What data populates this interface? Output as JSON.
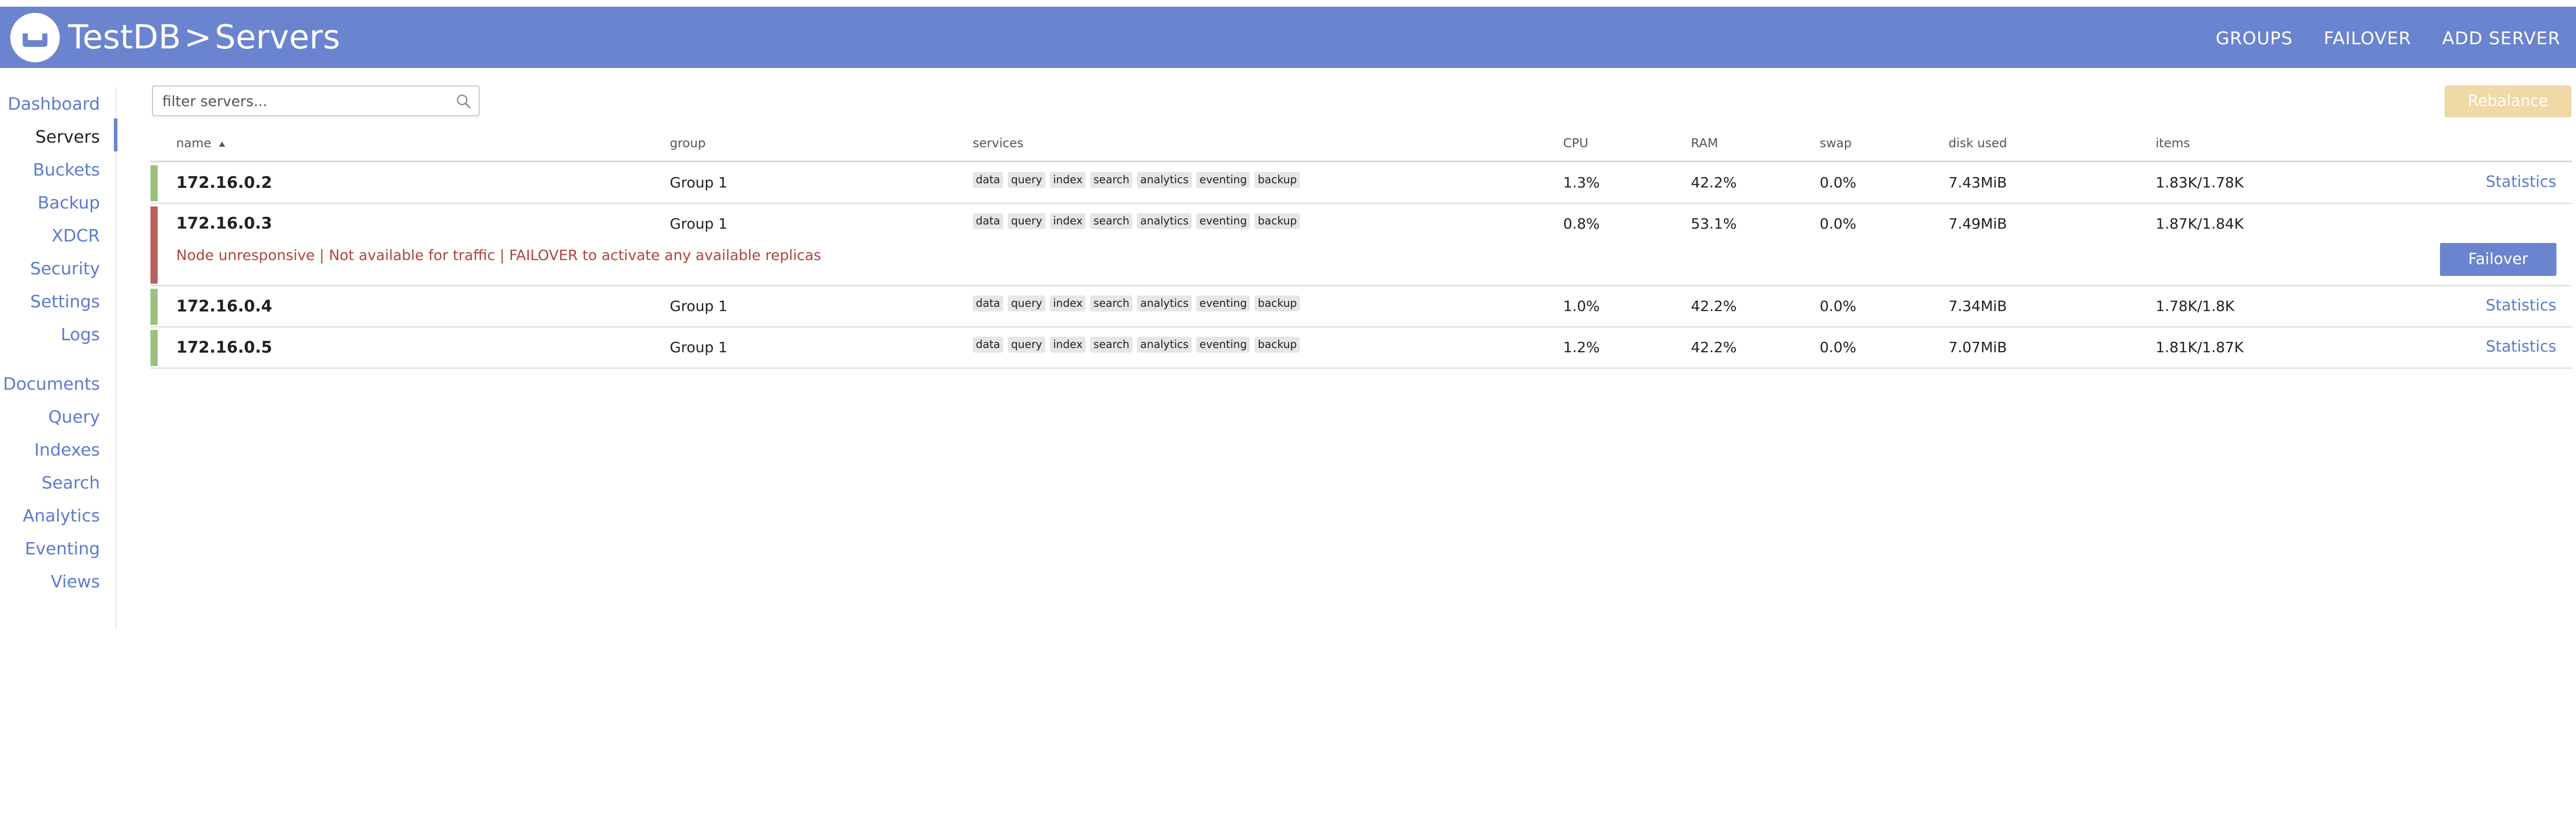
{
  "header": {
    "app": "TestDB",
    "separator": ">",
    "page": "Servers",
    "actions": [
      "GROUPS",
      "FAILOVER",
      "ADD SERVER"
    ],
    "color": "#6b84d0"
  },
  "sidebar": {
    "active": "Servers",
    "items": [
      "Dashboard",
      "Servers",
      "Buckets",
      "Backup",
      "XDCR",
      "Security",
      "Settings",
      "Logs"
    ],
    "items2": [
      "Documents",
      "Query",
      "Indexes",
      "Search",
      "Analytics",
      "Eventing",
      "Views"
    ]
  },
  "filter": {
    "placeholder": "filter servers..."
  },
  "rebalance_label": "Rebalance",
  "columns": {
    "name": "name",
    "group": "group",
    "services": "services",
    "cpu": "CPU",
    "ram": "RAM",
    "swap": "swap",
    "disk": "disk used",
    "items": "items",
    "sort": "name ascending"
  },
  "rows": [
    {
      "name": "172.16.0.2",
      "group": "Group 1",
      "services": [
        "data",
        "query",
        "index",
        "search",
        "analytics",
        "eventing",
        "backup"
      ],
      "cpu": "1.3%",
      "ram": "42.2%",
      "swap": "0.0%",
      "disk": "7.43MiB",
      "items": "1.83K/1.78K",
      "action": "Statistics",
      "status": "healthy",
      "status_color": "#9cc17e"
    },
    {
      "name": "172.16.0.3",
      "group": "Group 1",
      "services": [
        "data",
        "query",
        "index",
        "search",
        "analytics",
        "eventing",
        "backup"
      ],
      "cpu": "0.8%",
      "ram": "53.1%",
      "swap": "0.0%",
      "disk": "7.49MiB",
      "items": "1.87K/1.84K",
      "warning": "Node unresponsive | Not available for traffic | FAILOVER to activate any available replicas",
      "action": "Failover",
      "status": "unresponsive",
      "status_color": "#b8615f"
    },
    {
      "name": "172.16.0.4",
      "group": "Group 1",
      "services": [
        "data",
        "query",
        "index",
        "search",
        "analytics",
        "eventing",
        "backup"
      ],
      "cpu": "1.0%",
      "ram": "42.2%",
      "swap": "0.0%",
      "disk": "7.34MiB",
      "items": "1.78K/1.8K",
      "action": "Statistics",
      "status": "healthy",
      "status_color": "#9cc17e"
    },
    {
      "name": "172.16.0.5",
      "group": "Group 1",
      "services": [
        "data",
        "query",
        "index",
        "search",
        "analytics",
        "eventing",
        "backup"
      ],
      "cpu": "1.2%",
      "ram": "42.2%",
      "swap": "0.0%",
      "disk": "7.07MiB",
      "items": "1.81K/1.87K",
      "action": "Statistics",
      "status": "healthy",
      "status_color": "#9cc17e"
    }
  ],
  "icons": {
    "logo": "couchbase-logo-icon",
    "search": "search-icon",
    "sort": "sort-ascending-icon"
  }
}
